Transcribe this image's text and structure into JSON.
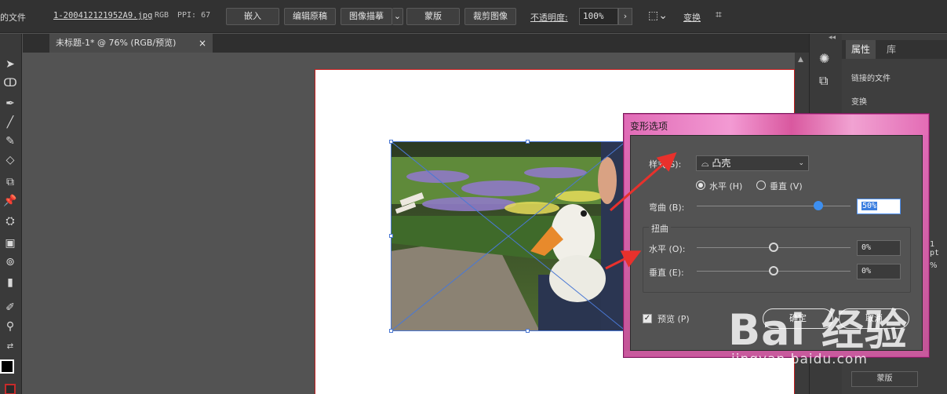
{
  "control_bar": {
    "linked_file_label": "的文件",
    "filename": "1-200412121952A9.jpg",
    "color_mode": "RGB",
    "ppi": "PPI: 67",
    "embed_label": "嵌入",
    "edit_original_label": "编辑原稿",
    "image_trace_label": "图像描摹",
    "mask_label": "蒙版",
    "crop_label": "裁剪图像",
    "opacity_label": "不透明度:",
    "opacity_value": "100%",
    "transform_label": "变换"
  },
  "document_tab": {
    "title": "未标题-1* @ 76% (RGB/预览)",
    "close": "×"
  },
  "properties_panel": {
    "tabs": [
      "属性",
      "库"
    ],
    "linked_file_heading": "链接的文件",
    "transform_heading": "变换",
    "stroke_fragment": "1 pt",
    "percent_fragment": "%",
    "mask_button": "蒙版"
  },
  "dialog": {
    "title": "变形选项",
    "style_label": "样式(S):",
    "style_value": "凸壳",
    "orientation": {
      "horizontal_label": "水平 (H)",
      "vertical_label": "垂直 (V)",
      "selected": "horizontal"
    },
    "bend_label": "弯曲 (B):",
    "bend_value": "50%",
    "bend_level": 0.5,
    "distortion_heading": "扭曲",
    "distort_h_label": "水平 (O):",
    "distort_h_value": "0%",
    "distort_v_label": "垂直 (E):",
    "distort_v_value": "0%",
    "preview_label": "预览 (P)",
    "preview_checked": true,
    "ok_label": "确定",
    "cancel_label": "取消"
  },
  "watermark": {
    "brand": "Bai 经验",
    "url": "jingyan.baidu.com"
  },
  "colors": {
    "dialog_title_pink": "#e36cb5",
    "annotation_arrow": "#e8312c",
    "slider_blue": "#3d8ff0",
    "artboard_border": "#c61d1d"
  }
}
